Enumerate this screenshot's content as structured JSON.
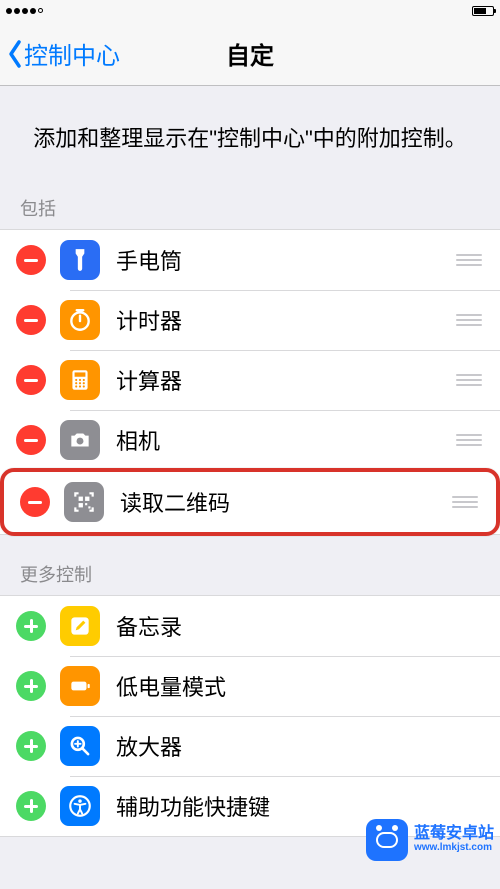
{
  "statusbar": {},
  "nav": {
    "back_label": "控制中心",
    "title": "自定"
  },
  "intro": "添加和整理显示在\"控制中心\"中的附加控制。",
  "sections": {
    "included_header": "包括",
    "more_header": "更多控制"
  },
  "included": [
    {
      "label": "手电筒"
    },
    {
      "label": "计时器"
    },
    {
      "label": "计算器"
    },
    {
      "label": "相机"
    },
    {
      "label": "读取二维码"
    }
  ],
  "more": [
    {
      "label": "备忘录"
    },
    {
      "label": "低电量模式"
    },
    {
      "label": "放大器"
    },
    {
      "label": "辅助功能快捷键"
    }
  ],
  "watermark": {
    "line1": "蓝莓安卓站",
    "line2": "www.lmkjst.com"
  }
}
